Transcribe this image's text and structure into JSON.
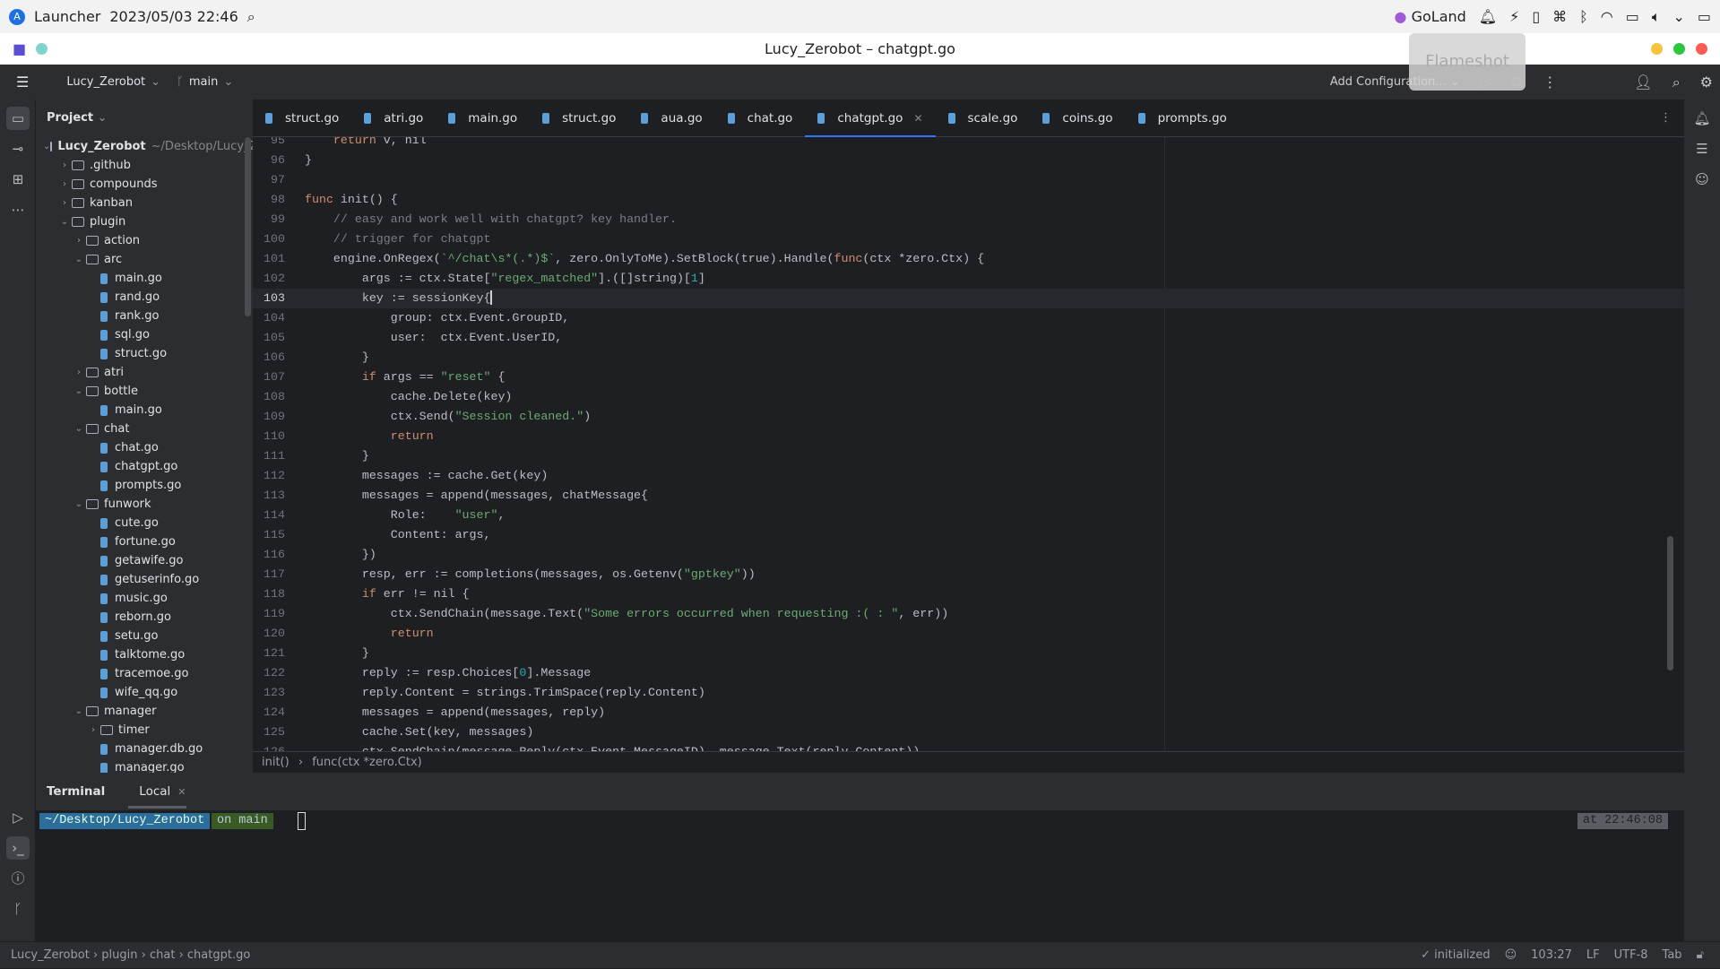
{
  "system_bar": {
    "launcher": "Launcher",
    "datetime": "2023/05/03 22:46",
    "app": "GoLand"
  },
  "window": {
    "title": "Lucy_Zerobot – chatgpt.go"
  },
  "tooltip": "Flameshot",
  "toolbar": {
    "project": "Lucy_Zerobot",
    "branch": "main",
    "run_config": "Add Configuration..."
  },
  "project_panel": {
    "title": "Project",
    "tree": [
      {
        "d": 0,
        "k": "folder",
        "o": true,
        "n": "Lucy_Zerobot",
        "hint": "~/Desktop/Lucy_Zerobot"
      },
      {
        "d": 1,
        "k": "folder",
        "o": false,
        "n": ".github"
      },
      {
        "d": 1,
        "k": "folder",
        "o": false,
        "n": "compounds"
      },
      {
        "d": 1,
        "k": "folder",
        "o": false,
        "n": "kanban"
      },
      {
        "d": 1,
        "k": "folder",
        "o": true,
        "n": "plugin"
      },
      {
        "d": 2,
        "k": "folder",
        "o": false,
        "n": "action"
      },
      {
        "d": 2,
        "k": "folder",
        "o": true,
        "n": "arc"
      },
      {
        "d": 3,
        "k": "file",
        "n": "main.go"
      },
      {
        "d": 3,
        "k": "file",
        "n": "rand.go"
      },
      {
        "d": 3,
        "k": "file",
        "n": "rank.go"
      },
      {
        "d": 3,
        "k": "file",
        "n": "sql.go"
      },
      {
        "d": 3,
        "k": "file",
        "n": "struct.go"
      },
      {
        "d": 2,
        "k": "folder",
        "o": false,
        "n": "atri"
      },
      {
        "d": 2,
        "k": "folder",
        "o": true,
        "n": "bottle"
      },
      {
        "d": 3,
        "k": "file",
        "n": "main.go"
      },
      {
        "d": 2,
        "k": "folder",
        "o": true,
        "n": "chat"
      },
      {
        "d": 3,
        "k": "file",
        "n": "chat.go"
      },
      {
        "d": 3,
        "k": "file",
        "n": "chatgpt.go"
      },
      {
        "d": 3,
        "k": "file",
        "n": "prompts.go"
      },
      {
        "d": 2,
        "k": "folder",
        "o": true,
        "n": "funwork"
      },
      {
        "d": 3,
        "k": "file",
        "n": "cute.go"
      },
      {
        "d": 3,
        "k": "file",
        "n": "fortune.go"
      },
      {
        "d": 3,
        "k": "file",
        "n": "getawife.go"
      },
      {
        "d": 3,
        "k": "file",
        "n": "getuserinfo.go"
      },
      {
        "d": 3,
        "k": "file",
        "n": "music.go"
      },
      {
        "d": 3,
        "k": "file",
        "n": "reborn.go"
      },
      {
        "d": 3,
        "k": "file",
        "n": "setu.go"
      },
      {
        "d": 3,
        "k": "file",
        "n": "talktome.go"
      },
      {
        "d": 3,
        "k": "file",
        "n": "tracemoe.go"
      },
      {
        "d": 3,
        "k": "file",
        "n": "wife_qq.go"
      },
      {
        "d": 2,
        "k": "folder",
        "o": true,
        "n": "manager"
      },
      {
        "d": 3,
        "k": "folder",
        "o": false,
        "n": "timer"
      },
      {
        "d": 3,
        "k": "file",
        "n": "manager.db.go"
      },
      {
        "d": 3,
        "k": "file",
        "n": "manager.go"
      }
    ]
  },
  "tabs": [
    {
      "label": "struct.go"
    },
    {
      "label": "atri.go"
    },
    {
      "label": "main.go"
    },
    {
      "label": "struct.go"
    },
    {
      "label": "aua.go"
    },
    {
      "label": "chat.go"
    },
    {
      "label": "chatgpt.go",
      "active": true
    },
    {
      "label": "scale.go"
    },
    {
      "label": "coins.go"
    },
    {
      "label": "prompts.go"
    }
  ],
  "editor": {
    "current_line": 103,
    "lines": [
      {
        "n": 95,
        "t": [
          [
            "    ",
            ""
          ],
          [
            "return",
            "kw"
          ],
          [
            " v, nil",
            ""
          ]
        ]
      },
      {
        "n": 96,
        "t": [
          [
            "}",
            ""
          ]
        ]
      },
      {
        "n": 97,
        "t": []
      },
      {
        "n": 98,
        "t": [
          [
            "func",
            "kw"
          ],
          [
            " init() {",
            ""
          ]
        ]
      },
      {
        "n": 99,
        "t": [
          [
            "    ",
            ""
          ],
          [
            "// easy and work well with chatgpt? key handler.",
            "cm"
          ]
        ]
      },
      {
        "n": 100,
        "t": [
          [
            "    ",
            ""
          ],
          [
            "// trigger for chatgpt",
            "cm"
          ]
        ]
      },
      {
        "n": 101,
        "t": [
          [
            "    engine.OnRegex(",
            ""
          ],
          [
            "`^/chat\\s*(.*)$`",
            "str"
          ],
          [
            ", zero.OnlyToMe).SetBlock(true).Handle(",
            ""
          ],
          [
            "func",
            "kw"
          ],
          [
            "(ctx *zero.Ctx) {",
            ""
          ]
        ]
      },
      {
        "n": 102,
        "t": [
          [
            "        args := ctx.State[",
            ""
          ],
          [
            "\"regex_matched\"",
            "str"
          ],
          [
            "].([]string)[",
            ""
          ],
          [
            "1",
            "num"
          ],
          [
            "]",
            ""
          ]
        ]
      },
      {
        "n": 103,
        "t": [
          [
            "        key := sessionKey{",
            ""
          ]
        ]
      },
      {
        "n": 104,
        "t": [
          [
            "            group: ctx.Event.GroupID,",
            ""
          ]
        ]
      },
      {
        "n": 105,
        "t": [
          [
            "            user:  ctx.Event.UserID,",
            ""
          ]
        ]
      },
      {
        "n": 106,
        "t": [
          [
            "        }",
            ""
          ]
        ]
      },
      {
        "n": 107,
        "t": [
          [
            "        ",
            ""
          ],
          [
            "if",
            "kw"
          ],
          [
            " args == ",
            ""
          ],
          [
            "\"reset\"",
            "str"
          ],
          [
            " {",
            ""
          ]
        ]
      },
      {
        "n": 108,
        "t": [
          [
            "            cache.Delete(key)",
            ""
          ]
        ]
      },
      {
        "n": 109,
        "t": [
          [
            "            ctx.Send(",
            ""
          ],
          [
            "\"Session cleaned.\"",
            "str"
          ],
          [
            ")",
            ""
          ]
        ]
      },
      {
        "n": 110,
        "t": [
          [
            "            ",
            ""
          ],
          [
            "return",
            "kw"
          ]
        ]
      },
      {
        "n": 111,
        "t": [
          [
            "        }",
            ""
          ]
        ]
      },
      {
        "n": 112,
        "t": [
          [
            "        messages := cache.Get(key)",
            ""
          ]
        ]
      },
      {
        "n": 113,
        "t": [
          [
            "        messages = append(messages, chatMessage{",
            ""
          ]
        ]
      },
      {
        "n": 114,
        "t": [
          [
            "            Role:    ",
            ""
          ],
          [
            "\"user\"",
            "str"
          ],
          [
            ",",
            ""
          ]
        ]
      },
      {
        "n": 115,
        "t": [
          [
            "            Content: args,",
            ""
          ]
        ]
      },
      {
        "n": 116,
        "t": [
          [
            "        })",
            ""
          ]
        ]
      },
      {
        "n": 117,
        "t": [
          [
            "        resp, err := completions(messages, os.Getenv(",
            ""
          ],
          [
            "\"gptkey\"",
            "str"
          ],
          [
            "))",
            ""
          ]
        ]
      },
      {
        "n": 118,
        "t": [
          [
            "        ",
            ""
          ],
          [
            "if",
            "kw"
          ],
          [
            " err != nil {",
            ""
          ]
        ]
      },
      {
        "n": 119,
        "t": [
          [
            "            ctx.SendChain(message.Text(",
            ""
          ],
          [
            "\"Some errors occurred when requesting :( : \"",
            "str"
          ],
          [
            ", err))",
            ""
          ]
        ]
      },
      {
        "n": 120,
        "t": [
          [
            "            ",
            ""
          ],
          [
            "return",
            "kw"
          ]
        ]
      },
      {
        "n": 121,
        "t": [
          [
            "        }",
            ""
          ]
        ]
      },
      {
        "n": 122,
        "t": [
          [
            "        reply := resp.Choices[",
            ""
          ],
          [
            "0",
            "num"
          ],
          [
            "].Message",
            ""
          ]
        ]
      },
      {
        "n": 123,
        "t": [
          [
            "        reply.Content = strings.TrimSpace(reply.Content)",
            ""
          ]
        ]
      },
      {
        "n": 124,
        "t": [
          [
            "        messages = append(messages, reply)",
            ""
          ]
        ]
      },
      {
        "n": 125,
        "t": [
          [
            "        cache.Set(key, messages)",
            ""
          ]
        ]
      },
      {
        "n": 126,
        "t": [
          [
            "        ctx.SendChain(message.Reply(ctx.Event.MessageID), message.Text(reply.Content))",
            ""
          ]
        ]
      }
    ]
  },
  "breadcrumbs": {
    "a": "init()",
    "b": "func(ctx *zero.Ctx)"
  },
  "terminal": {
    "title": "Terminal",
    "tab": "Local",
    "path": "~/Desktop/Lucy_Zerobot",
    "branch": "on main",
    "check": "✓",
    "time": "at 22:46:08"
  },
  "status": {
    "path": [
      "Lucy_Zerobot",
      "plugin",
      "chat",
      "chatgpt.go"
    ],
    "state": "initialized",
    "position": "103:27",
    "line_sep": "LF",
    "encoding": "UTF-8",
    "indent": "Tab"
  },
  "colors": {
    "accent": "#3574f0",
    "keyword": "#cf8e6d",
    "string": "#6aab73",
    "comment": "#7a7e85",
    "number": "#2aacb8"
  }
}
